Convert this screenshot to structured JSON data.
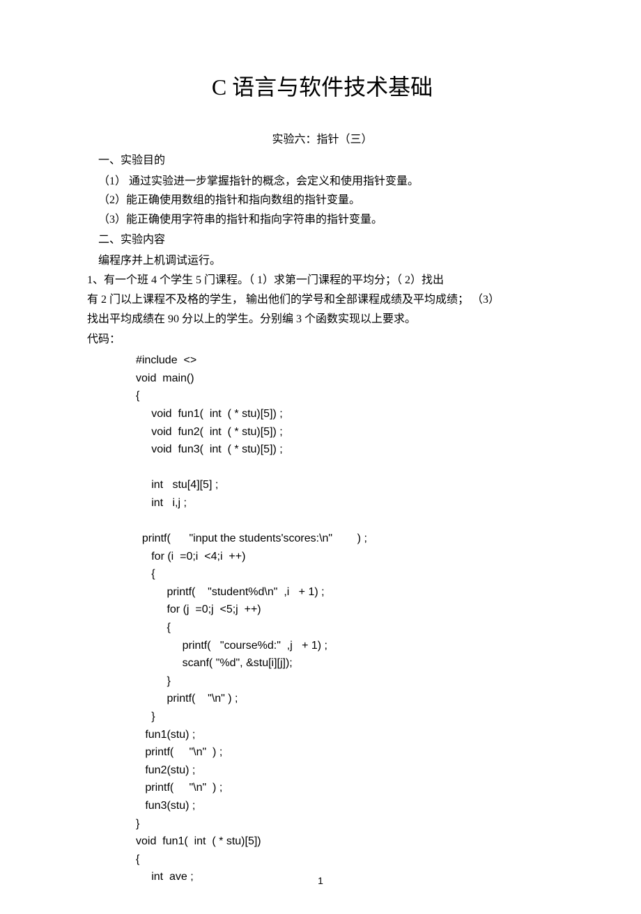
{
  "title": "C 语言与软件技术基础",
  "subtitle": "实验六：指针（三）",
  "section1": {
    "header": "一、实验目的",
    "items": [
      "（1） 通过实验进一步掌握指针的概念，会定义和使用指针变量。",
      "（2）能正确使用数组的指针和指向数组的指针变量。",
      "（3）能正确使用字符串的指针和指向字符串的指针变量。"
    ]
  },
  "section2": {
    "header": "二、实验内容",
    "intro": " 编程序并上机调试运行。"
  },
  "problem": {
    "line1": "    1、有一个班  4 个学生 5 门课程。（ 1）求第一门课程的平均分；（  2）找出",
    "line2": "有 2 门以上课程不及格的学生， 输出他们的学号和全部课程成绩及平均成绩；  （3）",
    "line3": "找出平均成绩在  90 分以上的学生。分别编   3 个函数实现以上要求。",
    "label": "    代码："
  },
  "code": "#include  <>\nvoid  main()\n{\n     void  fun1(  int  ( * stu)[5]) ;\n     void  fun2(  int  ( * stu)[5]) ;\n     void  fun3(  int  ( * stu)[5]) ;\n\n     int   stu[4][5] ;\n     int   i,j ;\n\n  printf(      \"input the students'scores:\\n\"        ) ;\n     for (i  =0;i  <4;i  ++)\n     {\n          printf(    \"student%d\\n\"  ,i   + 1) ;\n          for (j  =0;j  <5;j  ++)\n          {\n               printf(   \"course%d:\"  ,j   + 1) ;\n               scanf( \"%d\", &stu[i][j]);\n          }\n          printf(    \"\\n\" ) ;\n     }\n   fun1(stu) ;\n   printf(     \"\\n\"  ) ;\n   fun2(stu) ;\n   printf(     \"\\n\"  ) ;\n   fun3(stu) ;\n}\nvoid  fun1(  int  ( * stu)[5])\n{\n     int  ave ;",
  "pageNumber": "1"
}
